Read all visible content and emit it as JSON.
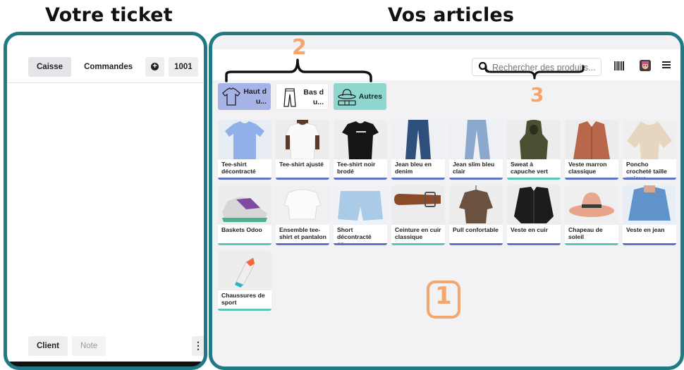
{
  "headings": {
    "left": "Votre ticket",
    "right": "Vos articles"
  },
  "ticket": {
    "tabs": [
      {
        "label": "Caisse",
        "active": true
      },
      {
        "label": "Commandes",
        "active": false
      }
    ],
    "order_number": "1001",
    "client_label": "Client",
    "note_label": "Note"
  },
  "toolbar": {
    "search_placeholder": "Rechercher des produits...",
    "icons": [
      "search-icon",
      "barcode-icon",
      "user-avatar",
      "hamburger-menu-icon"
    ]
  },
  "categories": [
    {
      "label": "Haut du...",
      "icon": "tshirt-icon",
      "color": "#a6b3e6"
    },
    {
      "label": "Bas du...",
      "icon": "pants-icon",
      "color": "#ffffff"
    },
    {
      "label": "Autres",
      "icon": "hat-belt-icon",
      "color": "#8fd6ce"
    }
  ],
  "products": [
    {
      "name": "Tee-shirt décontracté",
      "stripe": "#5f74c9"
    },
    {
      "name": "Tee-shirt ajusté",
      "stripe": "#5f74c9"
    },
    {
      "name": "Tee-shirt noir brodé",
      "stripe": "#5f74c9"
    },
    {
      "name": "Jean bleu en denim",
      "stripe": "#5f74c9"
    },
    {
      "name": "Jean slim bleu clair",
      "stripe": "#5f74c9"
    },
    {
      "name": "Sweat à capuche vert",
      "stripe": "#5bc6b8"
    },
    {
      "name": "Veste marron classique",
      "stripe": "#5f74c9"
    },
    {
      "name": "Poncho crocheté taille unique",
      "stripe": "#5f74c9"
    },
    {
      "name": "Baskets Odoo",
      "stripe": "#5bc6b8"
    },
    {
      "name": "Ensemble tee-shirt et pantalon",
      "stripe": "#5f74c9"
    },
    {
      "name": "Short décontracté en...",
      "stripe": "#5f74c9"
    },
    {
      "name": "Ceinture en cuir classique",
      "stripe": "#5bc6b8"
    },
    {
      "name": "Pull confortable",
      "stripe": "#5f74c9"
    },
    {
      "name": "Veste en cuir",
      "stripe": "#5f74c9"
    },
    {
      "name": "Chapeau de soleil",
      "stripe": "#5bc6b8"
    },
    {
      "name": "Veste en jean",
      "stripe": "#5f74c9"
    },
    {
      "name": "Chaussures de sport",
      "stripe": "#5bc6b8"
    }
  ],
  "annotations": {
    "one": "1",
    "two": "2",
    "three": "3"
  },
  "colors": {
    "frame": "#1f7a84",
    "annotation": "#f3a76f"
  }
}
